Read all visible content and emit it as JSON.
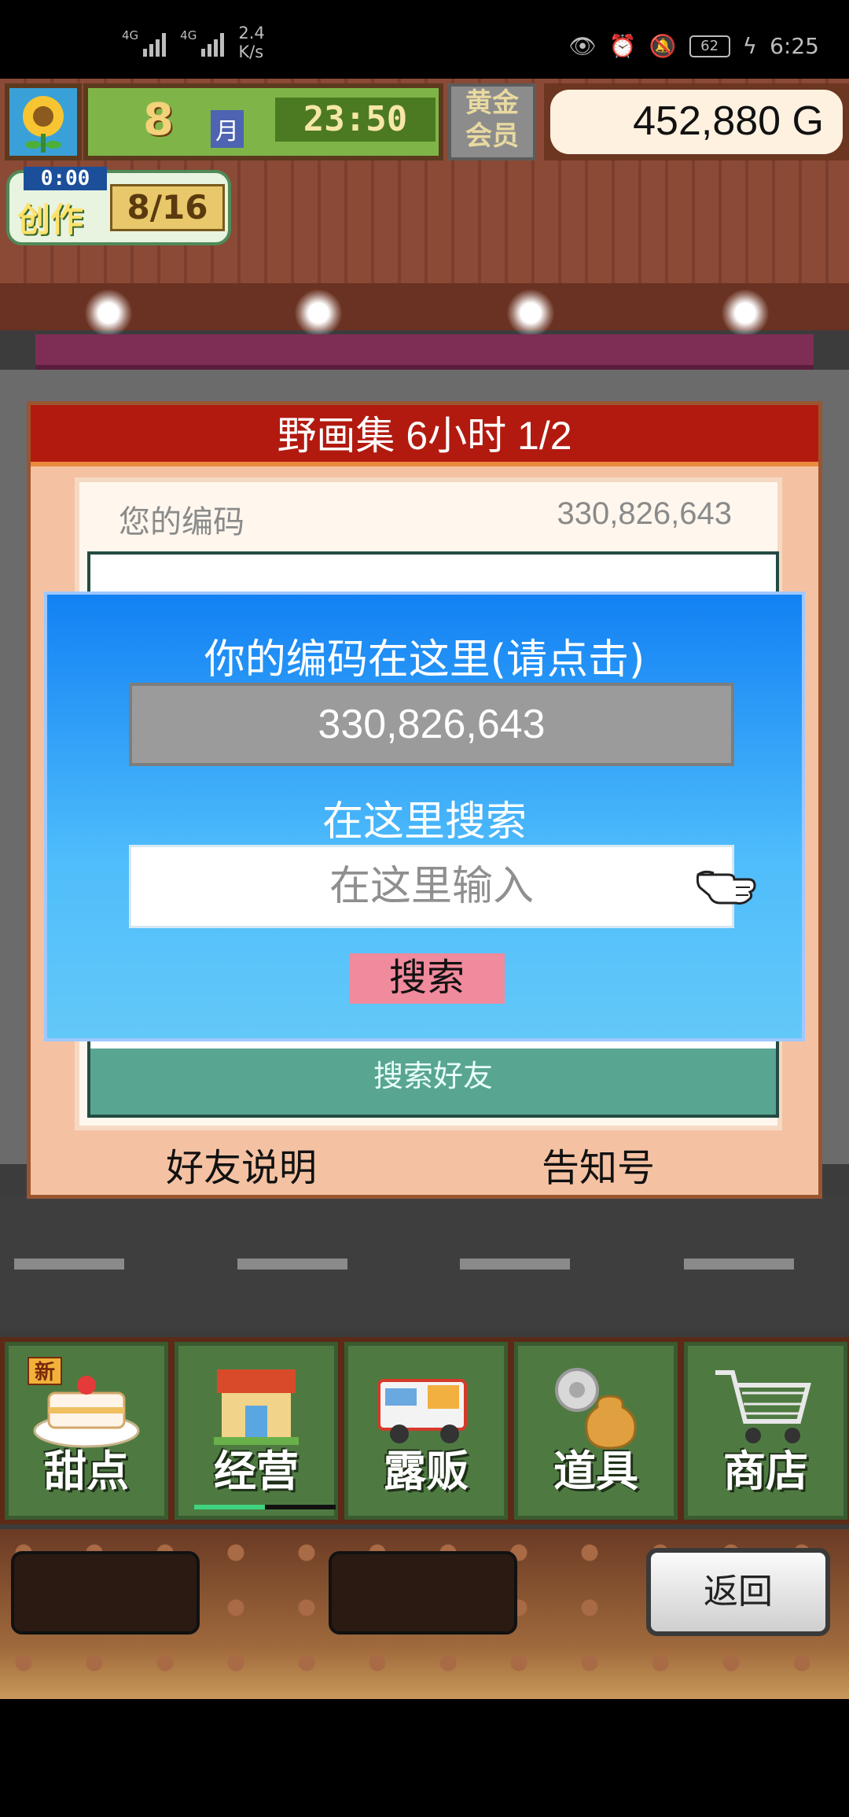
{
  "status_bar": {
    "signal_1": "4G",
    "signal_2": "4G",
    "net_speed": "2.4",
    "net_unit": "K/s",
    "battery": "62",
    "time": "6:25"
  },
  "hud": {
    "month": "8",
    "month_label": "月",
    "clock": "23:50",
    "member_line1": "黄金",
    "member_line2": "会员",
    "money": "452,880 G",
    "create_timer": "0:00",
    "create_label": "创作",
    "create_count": "8/16"
  },
  "dialog": {
    "title": "野画集  6小时 1/2",
    "code_label": "您的编码",
    "code_value": "330,826,643",
    "find_friend": "搜索好友",
    "friend_help": "好友说明",
    "notice": "告知号"
  },
  "popup": {
    "title": "你的编码在这里(请点击)",
    "code": "330,826,643",
    "search_label": "在这里搜索",
    "search_placeholder": "在这里输入",
    "search_button": "搜索"
  },
  "menu": {
    "items": [
      {
        "label": "甜点",
        "badge": "新",
        "icon": "cake-icon"
      },
      {
        "label": "经营",
        "icon": "shop-icon"
      },
      {
        "label": "露贩",
        "icon": "food-truck-icon"
      },
      {
        "label": "道具",
        "icon": "items-bag-icon"
      },
      {
        "label": "商店",
        "icon": "cart-icon"
      }
    ]
  },
  "footer": {
    "back_button": "返回"
  }
}
